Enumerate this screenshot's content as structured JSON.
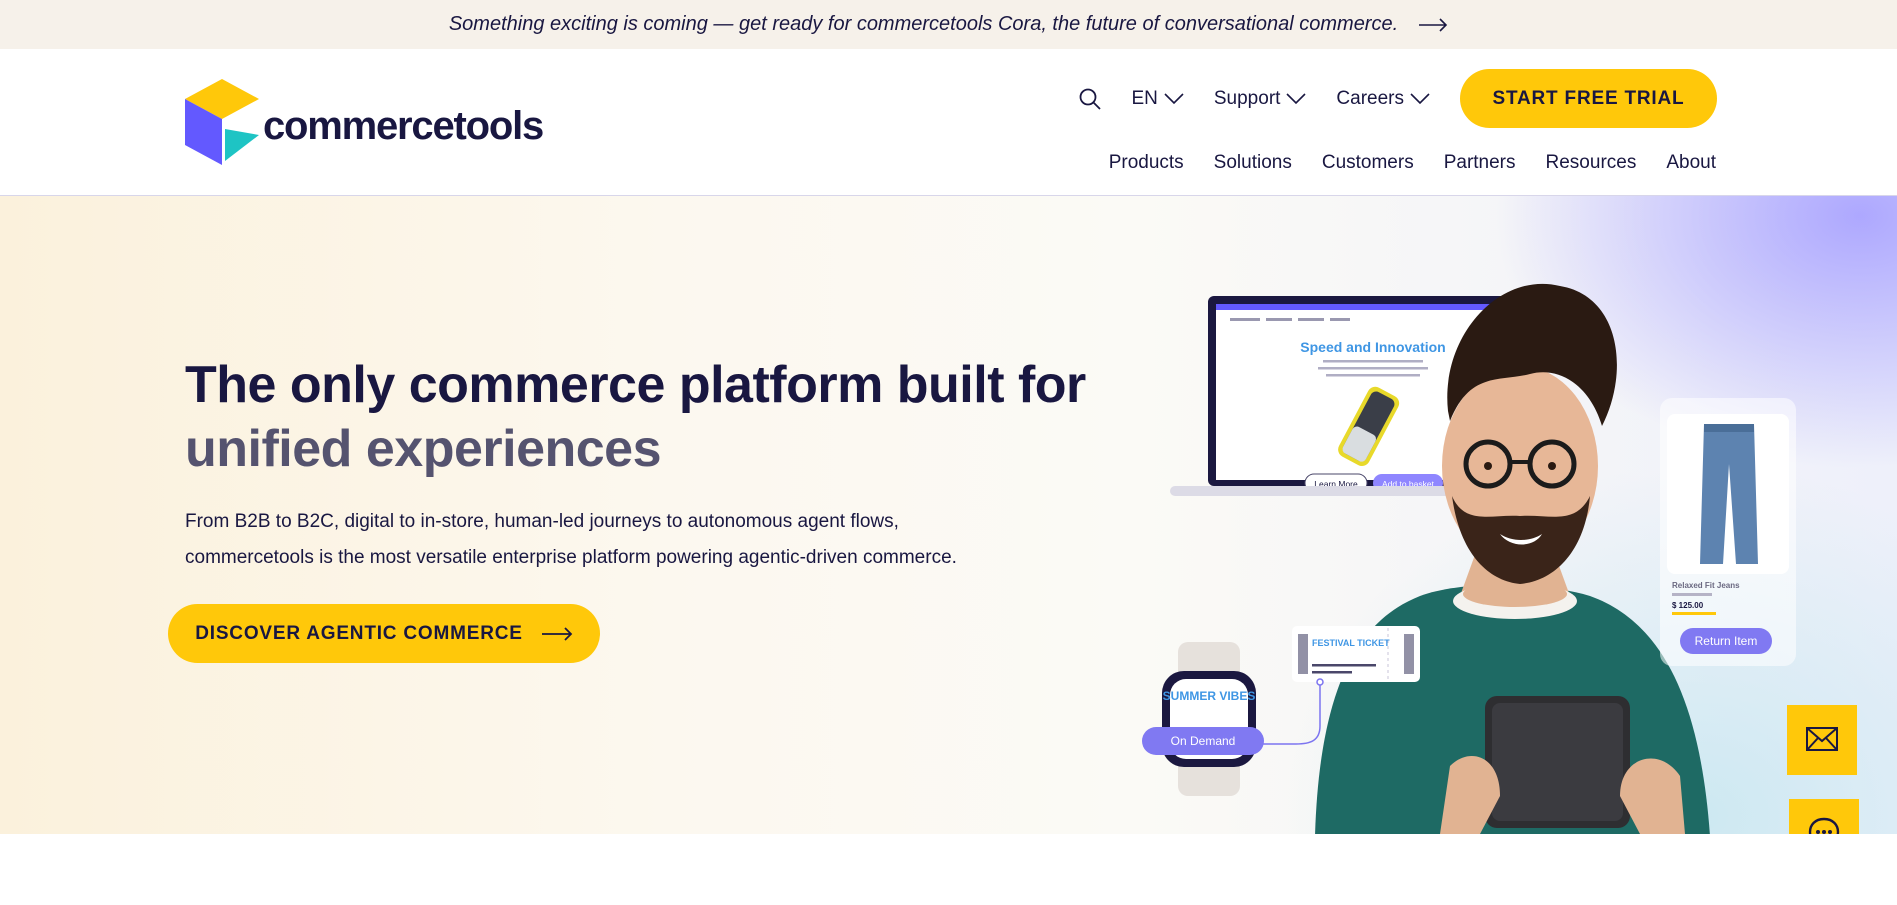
{
  "announcement": {
    "text": "Something exciting is coming — get ready for commercetools Cora, the future of conversational commerce."
  },
  "header": {
    "logo_text": "commercetools",
    "utility_nav": [
      {
        "label": "EN"
      },
      {
        "label": "Support"
      },
      {
        "label": "Careers"
      }
    ],
    "cta_label": "START FREE TRIAL",
    "main_nav": [
      {
        "label": "Products"
      },
      {
        "label": "Solutions"
      },
      {
        "label": "Customers"
      },
      {
        "label": "Partners"
      },
      {
        "label": "Resources"
      },
      {
        "label": "About"
      }
    ]
  },
  "hero": {
    "title_line1": "The only commerce platform built for",
    "title_line2": "unified experiences",
    "subtitle": "From B2B to B2C, digital to in-store, human-led journeys to autonomous agent flows, commercetools is the most versatile enterprise platform powering agentic-driven commerce.",
    "cta_label": "DISCOVER AGENTIC COMMERCE",
    "illustration": {
      "laptop_heading": "Speed and Innovation",
      "laptop_learn_more": "Learn More",
      "laptop_add_to_basket": "Add to basket",
      "ticket_title": "FESTIVAL TICKET",
      "watch_text": "SUMMER VIBES",
      "watch_button": "On Demand",
      "product_name": "Relaxed Fit Jeans",
      "product_price": "$ 125.00",
      "return_button": "Return Item"
    }
  },
  "colors": {
    "brand_yellow": "#ffc80a",
    "navy": "#191741",
    "purple": "#6359ff",
    "teal": "#1ec4c4",
    "accent_blue": "#3f96e4"
  },
  "icons": {
    "search": "search-icon",
    "chevron": "chevron-down-icon",
    "arrow": "arrow-right-icon",
    "mail": "mail-icon",
    "chat": "chat-icon"
  }
}
